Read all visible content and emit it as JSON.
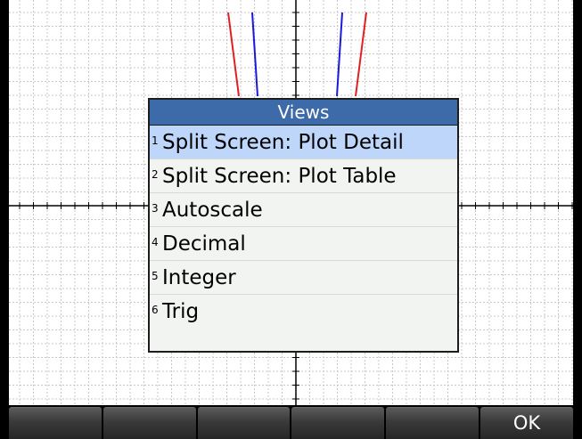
{
  "menu": {
    "title": "Views",
    "items": [
      {
        "num": "1",
        "label": "Split Screen: Plot Detail",
        "selected": true
      },
      {
        "num": "2",
        "label": "Split Screen: Plot Table",
        "selected": false
      },
      {
        "num": "3",
        "label": "Autoscale",
        "selected": false
      },
      {
        "num": "4",
        "label": "Decimal",
        "selected": false
      },
      {
        "num": "5",
        "label": "Integer",
        "selected": false
      },
      {
        "num": "6",
        "label": "Trig",
        "selected": false
      }
    ]
  },
  "softkeys": [
    "",
    "",
    "",
    "",
    "",
    "OK"
  ],
  "colors": {
    "menu_header": "#3d6aa8",
    "selected_item": "#bfd6fb",
    "curve_red": "#e02020",
    "curve_blue": "#1a1ad8",
    "grid": "#c8c8c8"
  }
}
